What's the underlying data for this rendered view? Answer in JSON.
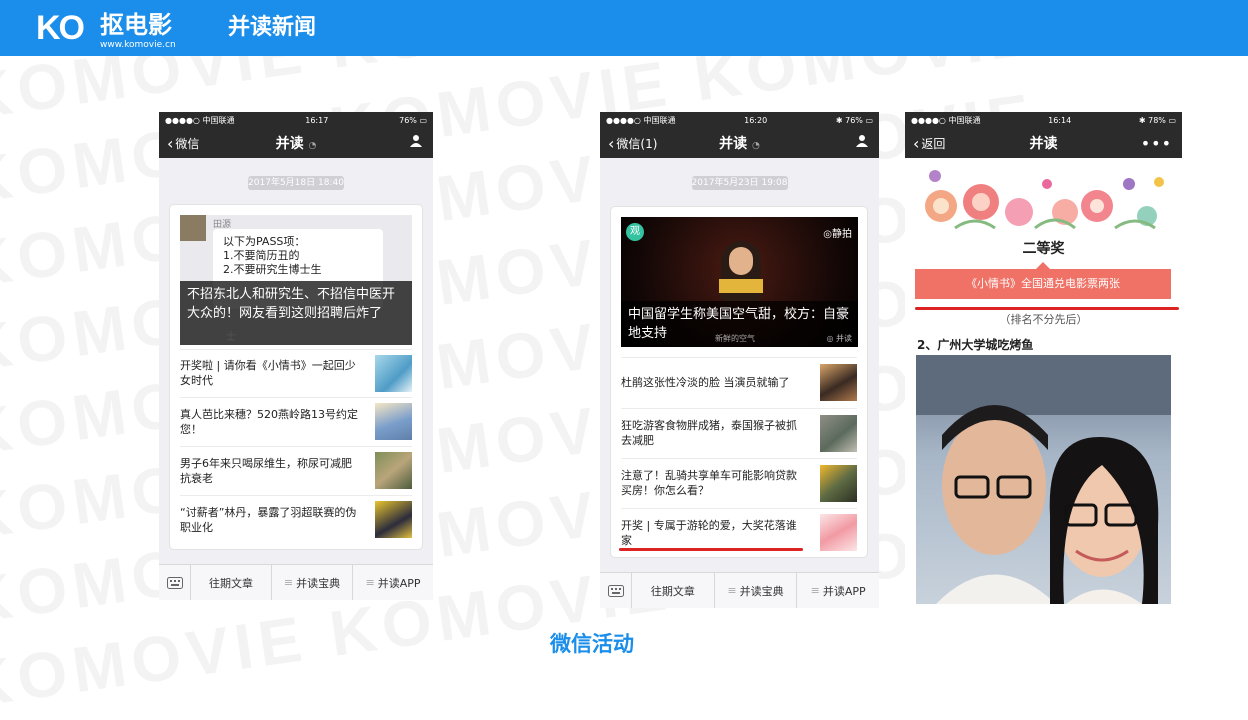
{
  "header": {
    "logo_mark": "KO",
    "brand_name": "抠电影",
    "brand_url": "www.komovie.cn",
    "title": "并读新闻"
  },
  "footer_caption": "微信活动",
  "watermark_text": "KOMOVIE",
  "colors": {
    "header_bg": "#1a8eea",
    "accent_blue": "#1a8eea",
    "prize_banner": "#f07266",
    "underline_red": "#dd2222"
  },
  "phone1": {
    "status": {
      "carrier": "●●●●○ 中国联通",
      "time": "16:17",
      "battery": "76%"
    },
    "nav": {
      "back": "微信",
      "title": "并读",
      "right_icon": "person-icon"
    },
    "timestamp": "2017年5月18日 18:40",
    "cover_chat": {
      "sender": "田源",
      "lines": [
        "以下为PASS项：",
        "1.不要简历丑的",
        "2.不要研究生博士生"
      ],
      "mark": "士"
    },
    "cover_caption": "不招东北人和研究生、不招信中医开大众的！网友看到这则招聘后炸了",
    "items": [
      {
        "title": "开奖啦 | 请你看《小情书》一起回少女时代"
      },
      {
        "title": "真人芭比来穗？520燕岭路13号约定您！"
      },
      {
        "title": "男子6年来只喝尿维生，称尿可减肥抗衰老"
      },
      {
        "title": "“讨薪者”林丹，暴露了羽超联赛的伪职业化"
      }
    ],
    "menu": [
      "往期文章",
      "并读宝典",
      "并读APP"
    ]
  },
  "phone2": {
    "status": {
      "carrier": "●●●●○ 中国联通",
      "time": "16:20",
      "battery": "76%"
    },
    "nav": {
      "back": "微信(1)",
      "title": "并读",
      "right_icon": "person-icon"
    },
    "timestamp": "2017年5月23日 19:08",
    "cover_badges": {
      "left": "观",
      "right": "◎静拍",
      "corner": "并读",
      "slogan": "新鲜的空气"
    },
    "cover_caption": "中国留学生称美国空气甜，校方：自豪地支持",
    "items": [
      {
        "title": "杜鹃这张性冷淡的脸 当演员就输了"
      },
      {
        "title": "狂吃游客食物胖成猪，泰国猴子被抓去减肥"
      },
      {
        "title": "注意了！乱骑共享单车可能影响贷款买房！你怎么看？"
      },
      {
        "title": "开奖 | 专属于游轮的爱，大奖花落谁家"
      }
    ],
    "menu": [
      "往期文章",
      "并读宝典",
      "并读APP"
    ]
  },
  "phone3": {
    "status": {
      "carrier": "●●●●○ 中国联通",
      "time": "16:14",
      "battery": "78%"
    },
    "nav": {
      "back": "返回",
      "title": "并读",
      "right_icon": "more-icon"
    },
    "prize_title": "二等奖",
    "prize_banner": "《小情书》全国通兑电影票两张",
    "prize_note": "（排名不分先后）",
    "winner_title": "2、广州大学城吃烤鱼"
  }
}
